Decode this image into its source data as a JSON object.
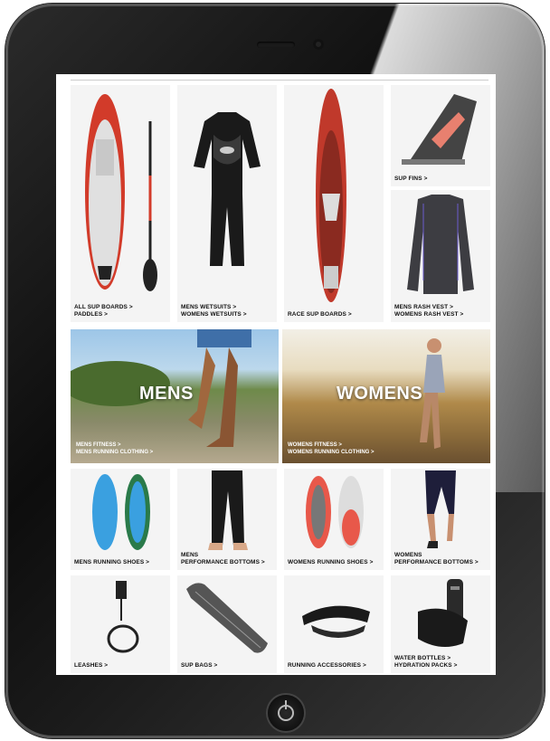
{
  "products": {
    "sup_boards": [
      "ALL SUP BOARDS >",
      "PADDLES >"
    ],
    "wetsuits": [
      "MENS WETSUITS >",
      "WOMENS WETSUITS >"
    ],
    "race_boards": [
      "RACE SUP BOARDS >"
    ],
    "fins": [
      "SUP FINS >"
    ],
    "rash_vests": [
      "MENS RASH VEST >",
      "WOMENS RASH VEST >"
    ],
    "mens_shoes": [
      "MENS RUNNING SHOES >"
    ],
    "mens_bottoms": [
      "MENS",
      "PERFORMANCE BOTTOMS >"
    ],
    "womens_shoes": [
      "WOMENS RUNNING SHOES >"
    ],
    "womens_bottoms": [
      "WOMENS",
      "PERFORMANCE BOTTOMS >"
    ],
    "leashes": [
      "LEASHES >"
    ],
    "sup_bags": [
      "SUP BAGS >"
    ],
    "running_accessories": [
      "RUNNING ACCESSORIES >"
    ],
    "water_bottles": [
      "WATER BOTTLES >",
      "HYDRATION PACKS >"
    ]
  },
  "banners": {
    "mens": {
      "title": "MENS",
      "links": [
        "MENS FITNESS >",
        "MENS RUNNING CLOTHING >"
      ]
    },
    "womens": {
      "title": "WOMENS",
      "links": [
        "WOMENS FITNESS >",
        "WOMENS RUNNING CLOTHING >"
      ]
    }
  },
  "colors": {
    "device": "#111111",
    "board_red": "#d23b2a",
    "shoe_blue": "#3aa0e0"
  }
}
